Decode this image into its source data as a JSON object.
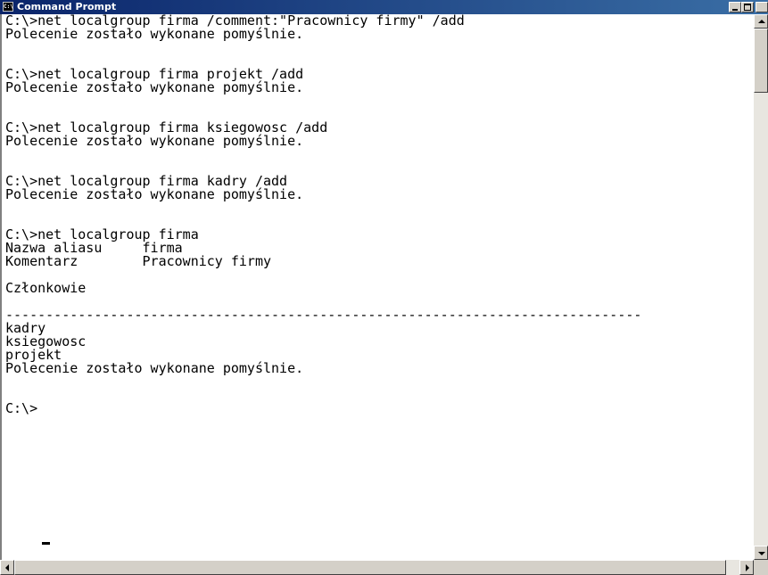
{
  "window": {
    "title": "Command Prompt",
    "icon_label": "C:\\",
    "title_bar_color": "#0a246a"
  },
  "console": {
    "background": "#ffffff",
    "text_color": "#000000",
    "lines": [
      "C:\\>net localgroup firma /comment:\"Pracownicy firmy\" /add",
      "Polecenie zostało wykonane pomyślnie.",
      "",
      "",
      "C:\\>net localgroup firma projekt /add",
      "Polecenie zostało wykonane pomyślnie.",
      "",
      "",
      "C:\\>net localgroup firma ksiegowosc /add",
      "Polecenie zostało wykonane pomyślnie.",
      "",
      "",
      "C:\\>net localgroup firma kadry /add",
      "Polecenie zostało wykonane pomyślnie.",
      "",
      "",
      "C:\\>net localgroup firma",
      "Nazwa aliasu     firma",
      "Komentarz        Pracownicy firmy",
      "",
      "Członkowie",
      "",
      "-------------------------------------------------------------------------------",
      "kadry",
      "ksiegowosc",
      "projekt",
      "Polecenie zostało wykonane pomyślnie.",
      "",
      "",
      "C:\\>"
    ]
  }
}
